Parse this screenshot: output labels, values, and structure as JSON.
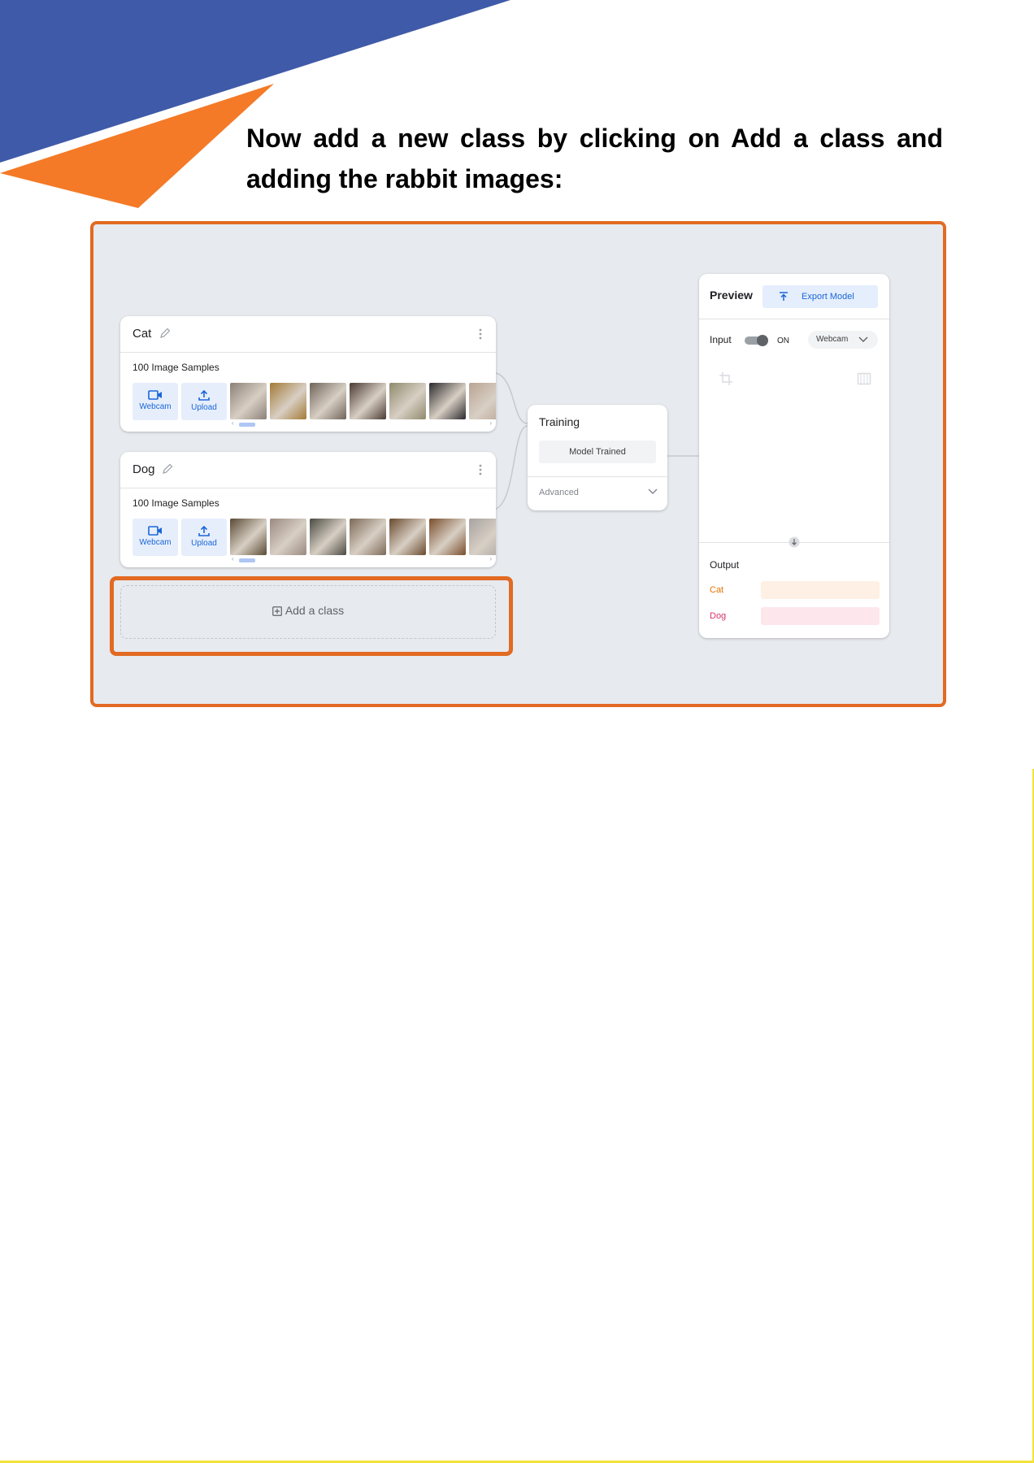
{
  "instruction": {
    "text": "Now add a new class by clicking on Add a class and adding the rabbit images:"
  },
  "classes": [
    {
      "name": "Cat",
      "samples_label": "100 Image Samples",
      "webcam_label": "Webcam",
      "upload_label": "Upload",
      "thumb_colors": [
        "#8b8178",
        "#a27a35",
        "#6f6459",
        "#4a3a33",
        "#8e8a6c",
        "#2c2a2c",
        "#b9a493"
      ]
    },
    {
      "name": "Dog",
      "samples_label": "100 Image Samples",
      "webcam_label": "Webcam",
      "upload_label": "Upload",
      "thumb_colors": [
        "#5a4a34",
        "#9a8a80",
        "#4a4a42",
        "#7d6a58",
        "#6a4a2e",
        "#7a4e2c",
        "#a7a3a0"
      ]
    }
  ],
  "add_class": {
    "label": "Add a class"
  },
  "training": {
    "title": "Training",
    "status_button": "Model Trained",
    "advanced_label": "Advanced"
  },
  "preview": {
    "title": "Preview",
    "export_label": "Export Model",
    "input_label": "Input",
    "toggle_state": "ON",
    "source_select": "Webcam",
    "output_label": "Output",
    "outputs": [
      {
        "label": "Cat",
        "label_color": "#e37400",
        "bar_color": "#fef0e4"
      },
      {
        "label": "Dog",
        "label_color": "#d6336c",
        "bar_color": "#fde7ec"
      }
    ]
  },
  "colors": {
    "highlight_orange": "#e26a22",
    "deco_blue": "#3f5aa8",
    "deco_orange": "#f47a27",
    "accent_blue": "#1a66d8"
  }
}
